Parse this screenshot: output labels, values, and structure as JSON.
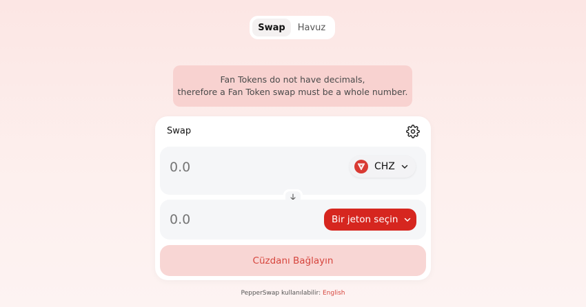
{
  "nav": {
    "tabs": [
      {
        "label": "Swap",
        "active": true
      },
      {
        "label": "Havuz",
        "active": false
      }
    ]
  },
  "notice": {
    "line1": "Fan Tokens do not have decimals,",
    "line2": "therefore a Fan Token swap must be a whole number."
  },
  "swap": {
    "title": "Swap",
    "settings_icon": "gear-icon",
    "from": {
      "amount_placeholder": "0.0",
      "token_symbol": "CHZ",
      "token_icon": "chiliz-logo-icon"
    },
    "to": {
      "amount_placeholder": "0.0",
      "select_label": "Bir jeton seçin"
    },
    "connect_label": "Cüzdanı Bağlayın"
  },
  "footer": {
    "text": "PepperSwap kullanılabilir:",
    "language": "English"
  },
  "colors": {
    "accent": "#d6261f",
    "connect_bg": "#f8d6d4",
    "notice_bg": "#f8d2d0"
  }
}
